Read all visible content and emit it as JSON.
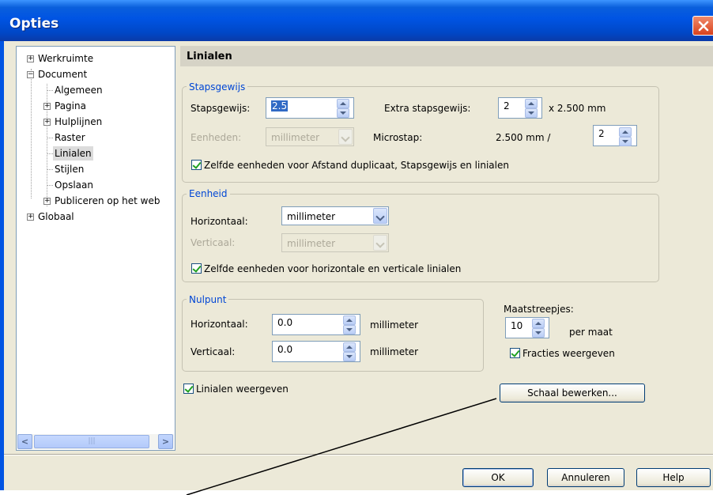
{
  "window": {
    "title": "Opties"
  },
  "tree": {
    "items": [
      {
        "label": "Werkruimte",
        "expander": "+"
      },
      {
        "label": "Document",
        "expander": "−"
      },
      {
        "label": "Algemeen"
      },
      {
        "label": "Pagina",
        "expander": "+"
      },
      {
        "label": "Hulplijnen",
        "expander": "+"
      },
      {
        "label": "Raster"
      },
      {
        "label": "Linialen",
        "selected": true
      },
      {
        "label": "Stijlen"
      },
      {
        "label": "Opslaan"
      },
      {
        "label": "Publiceren op het web",
        "expander": "+"
      },
      {
        "label": "Globaal",
        "expander": "+"
      }
    ],
    "scroll_left": "<",
    "scroll_thumb": "|||",
    "scroll_right": ">"
  },
  "panel": {
    "header": "Linialen"
  },
  "stapsgewijs": {
    "group_title": "Stapsgewijs",
    "step_label": "Stapsgewijs:",
    "step_value": "2.5",
    "extra_label": "Extra stapsgewijs:",
    "extra_value": "2",
    "extra_suffix": "x 2.500 mm",
    "units_label": "Eenheden:",
    "units_value": "millimeter",
    "microstap_label": "Microstap:",
    "microstap_text": "2.500 mm /",
    "microstap_value": "2",
    "same_units_label": "Zelfde eenheden voor Afstand duplicaat, Stapsgewijs en linialen"
  },
  "eenheid": {
    "group_title": "Eenheid",
    "horizontal_label": "Horizontaal:",
    "horizontal_value": "millimeter",
    "vertical_label": "Verticaal:",
    "vertical_value": "millimeter",
    "same_units_label": "Zelfde eenheden voor horizontale en verticale linialen"
  },
  "nulpunt": {
    "group_title": "Nulpunt",
    "horizontal_label": "Horizontaal:",
    "horizontal_value": "0.0",
    "horizontal_unit": "millimeter",
    "vertical_label": "Verticaal:",
    "vertical_value": "0.0",
    "vertical_unit": "millimeter"
  },
  "maatstreepjes": {
    "label": "Maatstreepjes:",
    "value": "10",
    "suffix": "per maat",
    "fractions_label": "Fracties weergeven"
  },
  "show_rulers_label": "Linialen weergeven",
  "scale_button": "Schaal bewerken...",
  "buttons": {
    "ok": "OK",
    "cancel": "Annuleren",
    "help": "Help"
  },
  "colors": {
    "titlebar": "#0054e3",
    "group_title": "#0046d5",
    "dialog_bg": "#ece9d8"
  }
}
